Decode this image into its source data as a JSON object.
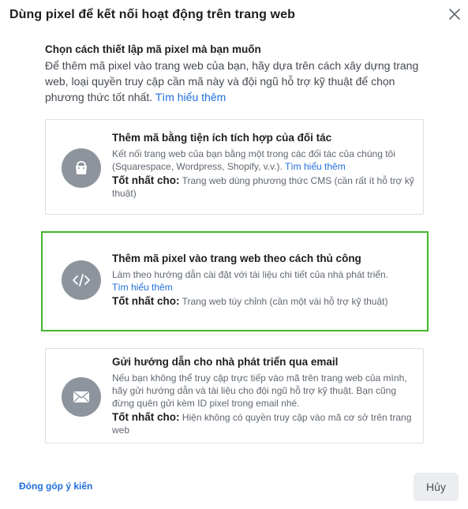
{
  "dialog": {
    "title": "Dùng pixel để kết nối hoạt động trên trang web",
    "close_icon": "close-icon"
  },
  "intro": {
    "heading": "Chọn cách thiết lập mã pixel mà bạn muốn",
    "text": "Để thêm mã pixel vào trang web của bạn, hãy dựa trên cách xây dựng trang web, loại quyền truy cập cần mã này và đội ngũ hỗ trợ kỹ thuật để chọn phương thức tốt nhất.",
    "link": "Tìm hiểu thêm"
  },
  "options": [
    {
      "icon": "shopping-bag-icon",
      "title": "Thêm mã bằng tiện ích tích hợp của đối tác",
      "desc": "Kết nối trang web của bạn bằng một trong các đối tác của chúng tôi (Squarespace, Wordpress, Shopify, v.v.).",
      "link": "Tìm hiểu thêm",
      "best_label": "Tốt nhất cho:",
      "best_text": "Trang web dùng phương thức CMS (cần rất ít hỗ trợ kỹ thuật)",
      "selected": false
    },
    {
      "icon": "code-icon",
      "title": "Thêm mã pixel vào trang web theo cách thủ công",
      "desc": "Làm theo hướng dẫn cài đặt với tài liệu chi tiết của nhà phát triển.",
      "link": "Tìm hiểu thêm",
      "best_label": "Tốt nhất cho:",
      "best_text": "Trang web tùy chỉnh (cần một vài hỗ trợ kỹ thuật)",
      "selected": true
    },
    {
      "icon": "envelope-icon",
      "title": "Gửi hướng dẫn cho nhà phát triển qua email",
      "desc": "Nếu bạn không thể truy cập trực tiếp vào mã trên trang web của mình, hãy gửi hướng dẫn và tài liệu cho đội ngũ hỗ trợ kỹ thuật. Bạn cũng đừng quên gửi kèm ID pixel trong email nhé.",
      "best_label": "Tốt nhất cho:",
      "best_text": "Hiện không có quyền truy cập vào mã cơ sở trên trang web",
      "selected": false
    }
  ],
  "footer": {
    "feedback_link": "Đóng góp ý kiến",
    "cancel_label": "Hủy"
  },
  "colors": {
    "selected_border": "#42b72a",
    "link": "#216fdb",
    "icon_circle": "#8d949e"
  }
}
